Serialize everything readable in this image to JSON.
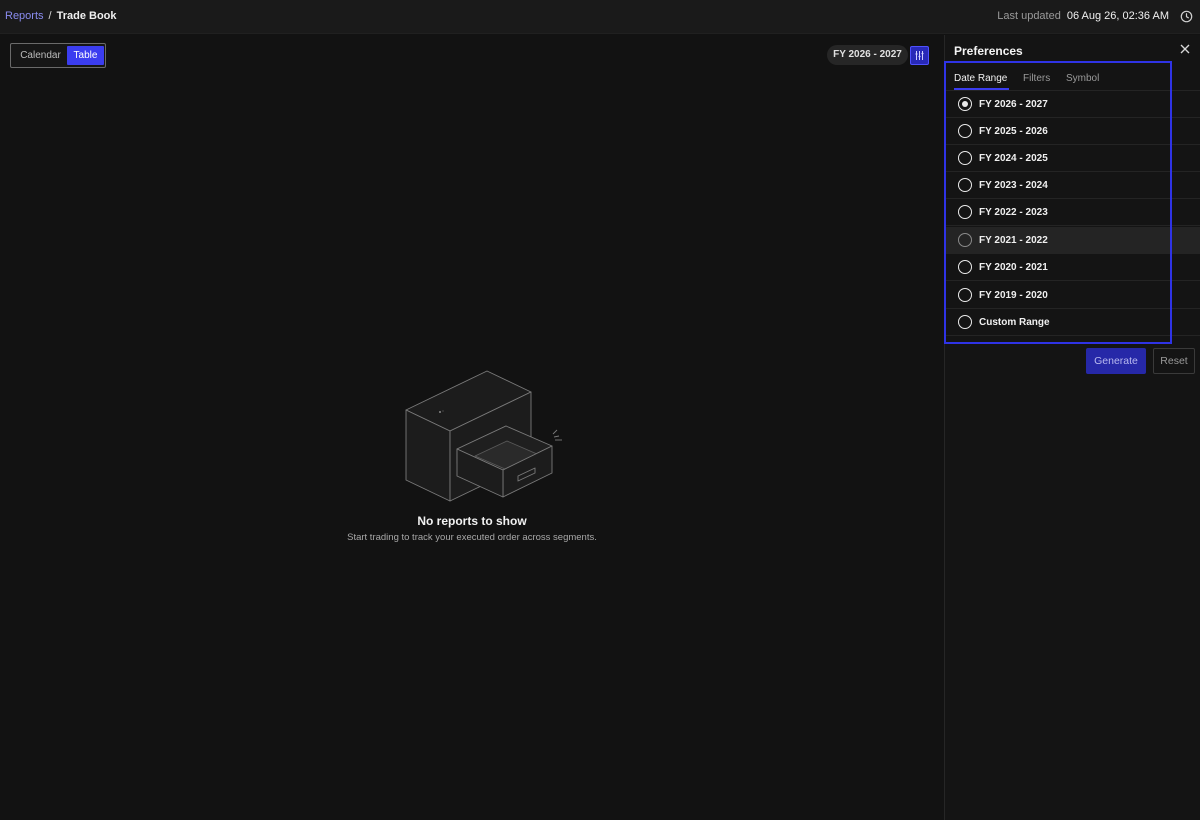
{
  "breadcrumb": {
    "parent": "Reports",
    "separator": "/",
    "current": "Trade Book"
  },
  "status": {
    "label": "Last updated",
    "value": "06 Aug 26, 02:36 AM",
    "icon": "clock-icon"
  },
  "view_toggle": {
    "calendar_label": "Calendar",
    "table_label": "Table",
    "active": "Table"
  },
  "selected_range": "FY 2026 - 2027",
  "filter_icon": "sliders-icon",
  "empty_state": {
    "title": "No reports to show",
    "subtitle": "Start trading to track your executed order across segments."
  },
  "preferences": {
    "title": "Preferences",
    "tabs": [
      {
        "label": "Date Range",
        "active": true
      },
      {
        "label": "Filters",
        "active": false
      },
      {
        "label": "Symbol",
        "active": false
      }
    ],
    "options": [
      {
        "label": "FY 2026 - 2027",
        "checked": true
      },
      {
        "label": "FY 2025 - 2026",
        "checked": false
      },
      {
        "label": "FY 2024 - 2025",
        "checked": false
      },
      {
        "label": "FY 2023 - 2024",
        "checked": false
      },
      {
        "label": "FY 2022 - 2023",
        "checked": false
      },
      {
        "label": "FY 2021 - 2022",
        "checked": false
      },
      {
        "label": "FY 2020 - 2021",
        "checked": false
      },
      {
        "label": "FY 2019 - 2020",
        "checked": false
      },
      {
        "label": "Custom Range",
        "checked": false
      }
    ],
    "generate_label": "Generate",
    "reset_label": "Reset"
  },
  "colors": {
    "accent": "#3b3df0",
    "background": "#121212",
    "panel": "#141414"
  }
}
